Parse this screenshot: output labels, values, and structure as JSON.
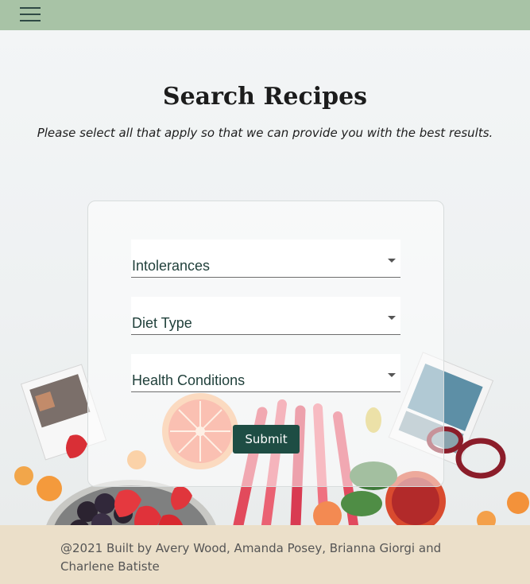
{
  "navbar": {
    "menu_icon": "hamburger-menu-icon"
  },
  "page": {
    "title": "Search Recipes",
    "subtitle": "Please select all that apply so that we can provide you with the best results."
  },
  "form": {
    "intolerances_label": "Intolerances",
    "diet_type_label": "Diet Type",
    "health_conditions_label": "Health Conditions",
    "submit_label": "Submit",
    "caret_icon": "caret-down-icon"
  },
  "footer": {
    "text": "@2021 Built by Avery Wood, Amanda Posey, Brianna Giorgi and Charlene Batiste"
  },
  "colors": {
    "navbar": "#a8c3a6",
    "submit": "#1e4d44",
    "footer": "#ebdfc9"
  }
}
